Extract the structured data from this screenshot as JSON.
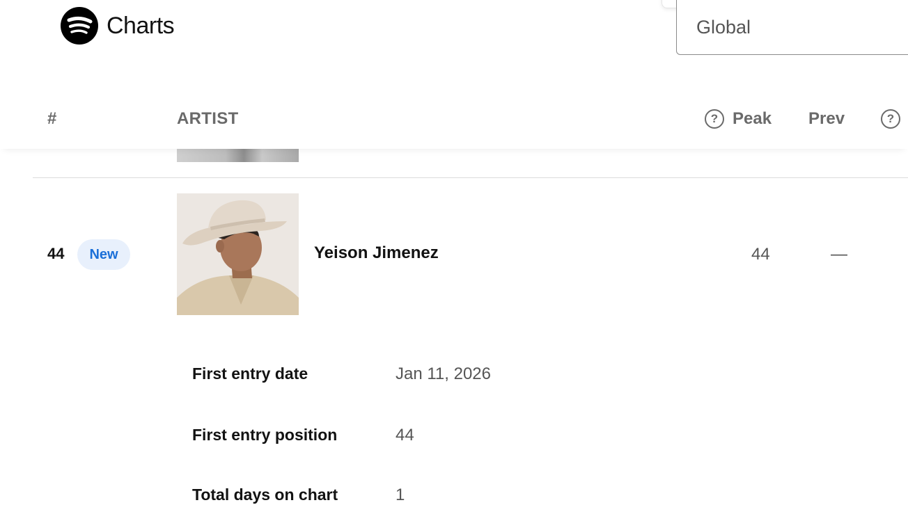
{
  "app": {
    "logo_text": "Charts"
  },
  "region_select": {
    "value": "Global"
  },
  "table_header": {
    "rank_label": "#",
    "artist_label": "ARTIST",
    "peak_label": "Peak",
    "prev_label": "Prev",
    "help_glyph": "?"
  },
  "row": {
    "rank": "44",
    "badge": "New",
    "artist": "Yeison Jimenez",
    "peak": "44",
    "prev": "—"
  },
  "details": [
    {
      "label": "First entry date",
      "value": "Jan 11, 2026"
    },
    {
      "label": "First entry position",
      "value": "44"
    },
    {
      "label": "Total days on chart",
      "value": "1"
    }
  ],
  "colors": {
    "badge_bg": "#e8f0fc",
    "badge_text": "#1a6fd8",
    "header_text": "#6a6a6a"
  }
}
